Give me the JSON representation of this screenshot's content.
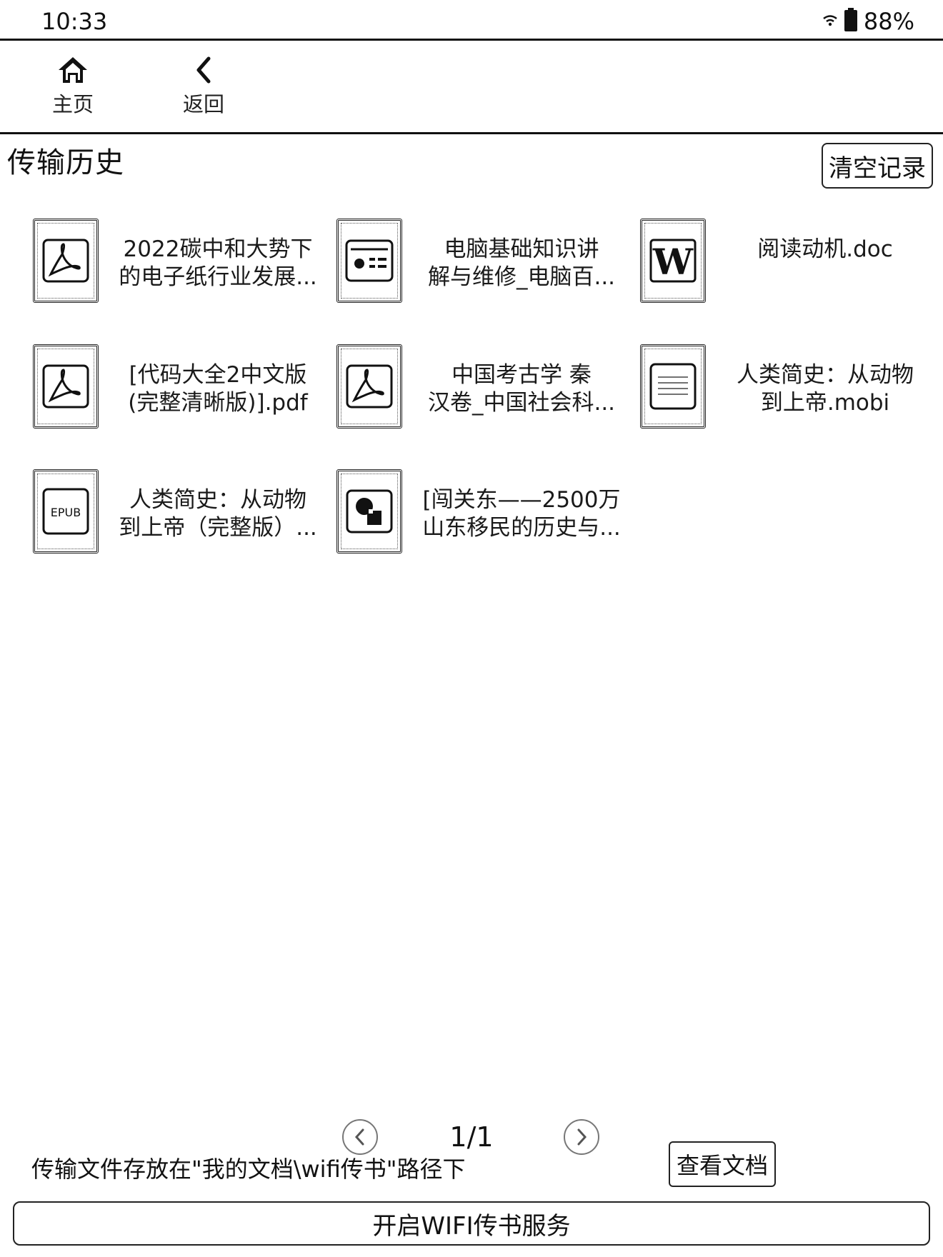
{
  "status_bar": {
    "time": "10:33",
    "battery": "88%",
    "wifi_icon": "wifi-icon",
    "battery_icon": "battery-icon"
  },
  "nav": {
    "home": {
      "label": "主页",
      "icon": "home-icon"
    },
    "back": {
      "label": "返回",
      "icon": "chevron-left-icon"
    }
  },
  "header": {
    "title": "传输历史",
    "clear_label": "清空记录"
  },
  "files": [
    {
      "line1": "2022碳中和大势下",
      "line2": "的电子纸行业发展...",
      "icon": "pdf-icon"
    },
    {
      "line1": "电脑基础知识讲",
      "line2": "解与维修_电脑百...",
      "icon": "id-card-icon"
    },
    {
      "line1": "阅读动机.doc",
      "line2": "",
      "icon": "word-icon"
    },
    {
      "line1": "[代码大全2中文版",
      "line2": "(完整清晰版)].pdf",
      "icon": "pdf-icon"
    },
    {
      "line1": "中国考古学  秦",
      "line2": "汉卷_中国社会科...",
      "icon": "pdf-icon"
    },
    {
      "line1": "人类简史：从动物",
      "line2": "到上帝.mobi",
      "icon": "text-doc-icon"
    },
    {
      "line1": "人类简史：从动物",
      "line2": "到上帝（完整版）...",
      "icon": "epub-icon",
      "badge": "EPUB"
    },
    {
      "line1": "[闯关东——2500万",
      "line2": "山东移民的历史与...",
      "icon": "shapes-icon"
    }
  ],
  "pager": {
    "indicator": "1/1",
    "prev_icon": "chevron-left-circle-icon",
    "next_icon": "chevron-right-circle-icon"
  },
  "footer": {
    "note": "传输文件存放在\"我的文档\\wifi传书\"路径下",
    "view_docs_label": "查看文档",
    "wifi_service_label": "开启WIFI传书服务"
  }
}
